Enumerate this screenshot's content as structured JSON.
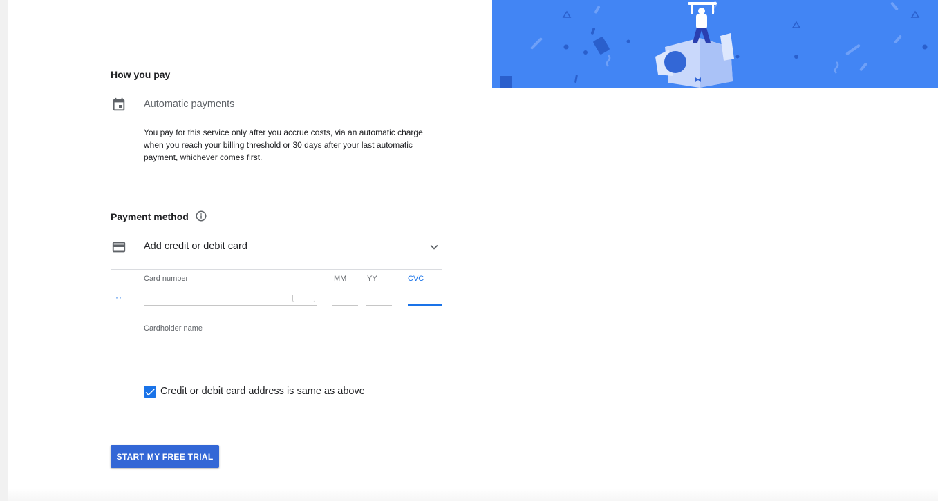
{
  "how_you_pay": {
    "title": "How you pay",
    "icon": "calendar-icon",
    "method_label": "Automatic payments",
    "description": "You pay for this service only after you accrue costs, via an automatic charge when you reach your billing threshold or 30 days after your last automatic payment, whichever comes first."
  },
  "payment_method": {
    "title": "Payment method",
    "info_icon": "info-icon",
    "card_row": {
      "icon": "credit-card-icon",
      "label": "Add credit or debit card",
      "expand_icon": "chevron-down-icon"
    },
    "fields": {
      "card_number": {
        "label": "Card number",
        "value": ""
      },
      "month": {
        "label": "MM",
        "value": ""
      },
      "year": {
        "label": "YY",
        "value": ""
      },
      "cvc": {
        "label": "CVC",
        "value": ""
      },
      "cardholder_name": {
        "label": "Cardholder name",
        "value": ""
      }
    },
    "address_checkbox": {
      "checked": true,
      "label": "Credit or debit card address is same as above"
    }
  },
  "submit": {
    "label": "START MY FREE TRIAL"
  },
  "colors": {
    "hero_background": "#4285f4",
    "accent": "#1a73e8",
    "button": "#3367d6"
  }
}
